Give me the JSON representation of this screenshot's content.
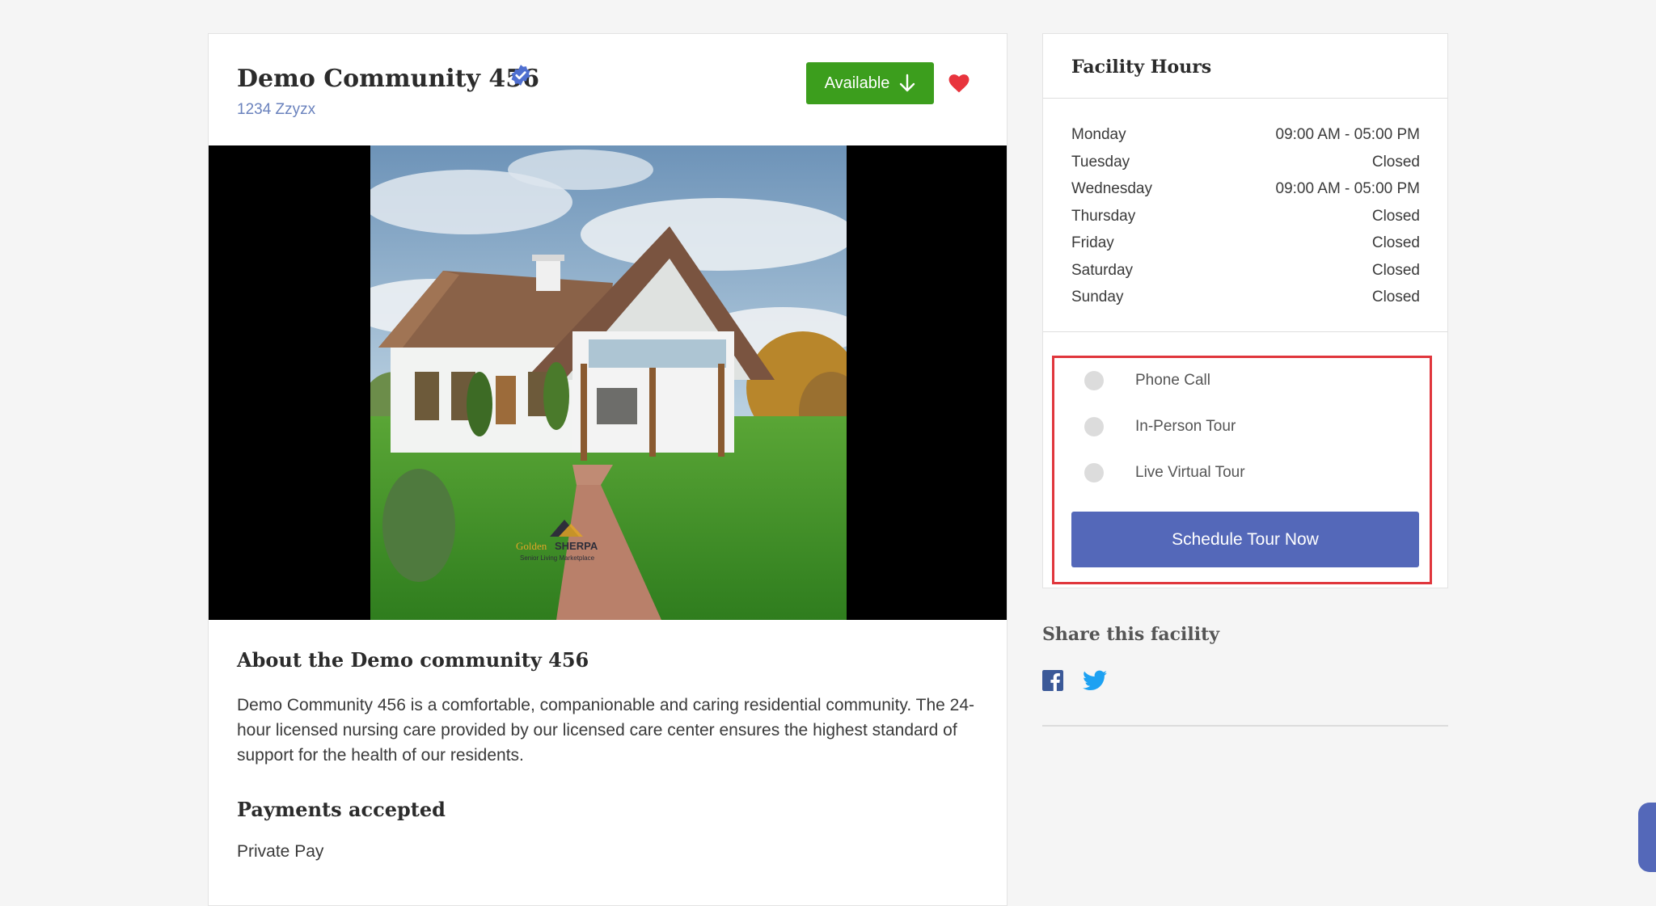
{
  "facility": {
    "name": "Demo Community 456",
    "address": "1234 Zzyzx",
    "availability_label": "Available"
  },
  "media": {
    "logo_text_1": "Golden",
    "logo_text_2": "SHERPA",
    "logo_tagline": "Senior Living Marketplace"
  },
  "about": {
    "title": "About the Demo community 456",
    "description": "Demo Community 456 is a comfortable, companionable and caring residential community. The 24-hour licensed nursing care provided by our licensed care center ensures the highest standard of support for the health of our residents."
  },
  "payments": {
    "title": "Payments accepted",
    "value": "Private Pay"
  },
  "hours": {
    "title": "Facility Hours",
    "days": [
      {
        "day": "Monday",
        "time": "09:00 AM - 05:00 PM"
      },
      {
        "day": "Tuesday",
        "time": "Closed"
      },
      {
        "day": "Wednesday",
        "time": "09:00 AM - 05:00 PM"
      },
      {
        "day": "Thursday",
        "time": "Closed"
      },
      {
        "day": "Friday",
        "time": "Closed"
      },
      {
        "day": "Saturday",
        "time": "Closed"
      },
      {
        "day": "Sunday",
        "time": "Closed"
      }
    ]
  },
  "tour": {
    "options": [
      {
        "label": "Phone Call",
        "selected": false
      },
      {
        "label": "In-Person Tour",
        "selected": false
      },
      {
        "label": "Live Virtual Tour",
        "selected": false
      }
    ],
    "schedule_label": "Schedule Tour Now"
  },
  "share": {
    "title": "Share this facility",
    "icons": [
      "facebook-icon",
      "twitter-icon"
    ]
  },
  "colors": {
    "available_green": "#3c9e1d",
    "primary_blue": "#5468b9",
    "heart_red": "#e8343d",
    "highlight_red": "#e0363c",
    "link_blue": "#6a82bd"
  }
}
